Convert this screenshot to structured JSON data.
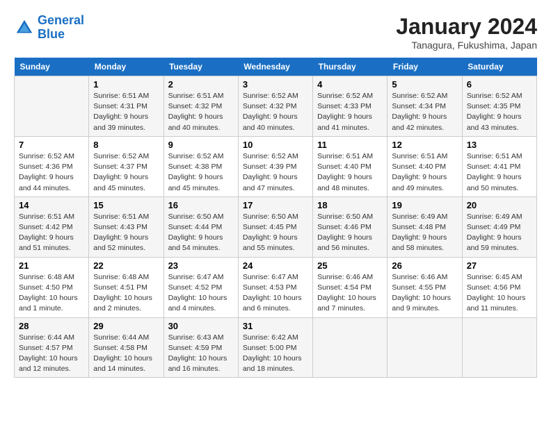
{
  "header": {
    "logo_line1": "General",
    "logo_line2": "Blue",
    "month_title": "January 2024",
    "location": "Tanagura, Fukushima, Japan"
  },
  "days_of_week": [
    "Sunday",
    "Monday",
    "Tuesday",
    "Wednesday",
    "Thursday",
    "Friday",
    "Saturday"
  ],
  "weeks": [
    [
      {
        "num": "",
        "info": ""
      },
      {
        "num": "1",
        "info": "Sunrise: 6:51 AM\nSunset: 4:31 PM\nDaylight: 9 hours\nand 39 minutes."
      },
      {
        "num": "2",
        "info": "Sunrise: 6:51 AM\nSunset: 4:32 PM\nDaylight: 9 hours\nand 40 minutes."
      },
      {
        "num": "3",
        "info": "Sunrise: 6:52 AM\nSunset: 4:32 PM\nDaylight: 9 hours\nand 40 minutes."
      },
      {
        "num": "4",
        "info": "Sunrise: 6:52 AM\nSunset: 4:33 PM\nDaylight: 9 hours\nand 41 minutes."
      },
      {
        "num": "5",
        "info": "Sunrise: 6:52 AM\nSunset: 4:34 PM\nDaylight: 9 hours\nand 42 minutes."
      },
      {
        "num": "6",
        "info": "Sunrise: 6:52 AM\nSunset: 4:35 PM\nDaylight: 9 hours\nand 43 minutes."
      }
    ],
    [
      {
        "num": "7",
        "info": "Sunrise: 6:52 AM\nSunset: 4:36 PM\nDaylight: 9 hours\nand 44 minutes."
      },
      {
        "num": "8",
        "info": "Sunrise: 6:52 AM\nSunset: 4:37 PM\nDaylight: 9 hours\nand 45 minutes."
      },
      {
        "num": "9",
        "info": "Sunrise: 6:52 AM\nSunset: 4:38 PM\nDaylight: 9 hours\nand 45 minutes."
      },
      {
        "num": "10",
        "info": "Sunrise: 6:52 AM\nSunset: 4:39 PM\nDaylight: 9 hours\nand 47 minutes."
      },
      {
        "num": "11",
        "info": "Sunrise: 6:51 AM\nSunset: 4:40 PM\nDaylight: 9 hours\nand 48 minutes."
      },
      {
        "num": "12",
        "info": "Sunrise: 6:51 AM\nSunset: 4:40 PM\nDaylight: 9 hours\nand 49 minutes."
      },
      {
        "num": "13",
        "info": "Sunrise: 6:51 AM\nSunset: 4:41 PM\nDaylight: 9 hours\nand 50 minutes."
      }
    ],
    [
      {
        "num": "14",
        "info": "Sunrise: 6:51 AM\nSunset: 4:42 PM\nDaylight: 9 hours\nand 51 minutes."
      },
      {
        "num": "15",
        "info": "Sunrise: 6:51 AM\nSunset: 4:43 PM\nDaylight: 9 hours\nand 52 minutes."
      },
      {
        "num": "16",
        "info": "Sunrise: 6:50 AM\nSunset: 4:44 PM\nDaylight: 9 hours\nand 54 minutes."
      },
      {
        "num": "17",
        "info": "Sunrise: 6:50 AM\nSunset: 4:45 PM\nDaylight: 9 hours\nand 55 minutes."
      },
      {
        "num": "18",
        "info": "Sunrise: 6:50 AM\nSunset: 4:46 PM\nDaylight: 9 hours\nand 56 minutes."
      },
      {
        "num": "19",
        "info": "Sunrise: 6:49 AM\nSunset: 4:48 PM\nDaylight: 9 hours\nand 58 minutes."
      },
      {
        "num": "20",
        "info": "Sunrise: 6:49 AM\nSunset: 4:49 PM\nDaylight: 9 hours\nand 59 minutes."
      }
    ],
    [
      {
        "num": "21",
        "info": "Sunrise: 6:48 AM\nSunset: 4:50 PM\nDaylight: 10 hours\nand 1 minute."
      },
      {
        "num": "22",
        "info": "Sunrise: 6:48 AM\nSunset: 4:51 PM\nDaylight: 10 hours\nand 2 minutes."
      },
      {
        "num": "23",
        "info": "Sunrise: 6:47 AM\nSunset: 4:52 PM\nDaylight: 10 hours\nand 4 minutes."
      },
      {
        "num": "24",
        "info": "Sunrise: 6:47 AM\nSunset: 4:53 PM\nDaylight: 10 hours\nand 6 minutes."
      },
      {
        "num": "25",
        "info": "Sunrise: 6:46 AM\nSunset: 4:54 PM\nDaylight: 10 hours\nand 7 minutes."
      },
      {
        "num": "26",
        "info": "Sunrise: 6:46 AM\nSunset: 4:55 PM\nDaylight: 10 hours\nand 9 minutes."
      },
      {
        "num": "27",
        "info": "Sunrise: 6:45 AM\nSunset: 4:56 PM\nDaylight: 10 hours\nand 11 minutes."
      }
    ],
    [
      {
        "num": "28",
        "info": "Sunrise: 6:44 AM\nSunset: 4:57 PM\nDaylight: 10 hours\nand 12 minutes."
      },
      {
        "num": "29",
        "info": "Sunrise: 6:44 AM\nSunset: 4:58 PM\nDaylight: 10 hours\nand 14 minutes."
      },
      {
        "num": "30",
        "info": "Sunrise: 6:43 AM\nSunset: 4:59 PM\nDaylight: 10 hours\nand 16 minutes."
      },
      {
        "num": "31",
        "info": "Sunrise: 6:42 AM\nSunset: 5:00 PM\nDaylight: 10 hours\nand 18 minutes."
      },
      {
        "num": "",
        "info": ""
      },
      {
        "num": "",
        "info": ""
      },
      {
        "num": "",
        "info": ""
      }
    ]
  ]
}
